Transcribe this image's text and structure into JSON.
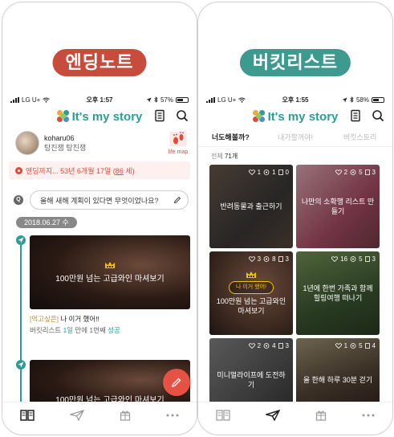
{
  "left": {
    "label": "엔딩노트",
    "status": {
      "carrier": "LG U+",
      "time": "오후 1:57",
      "battery": "57%",
      "battery_level": 0.57
    },
    "app": {
      "logo_text": "It's my story"
    },
    "profile": {
      "username": "koharu06",
      "subtitle": "탕진잼 탕진잼",
      "lifemap_label": "life map"
    },
    "ending": {
      "prefix": "엔딩까지... 53년 6개월 17일 (",
      "age": "86",
      "suffix": " 세)"
    },
    "question": {
      "badge": "Q",
      "text": "올해 새해 계획이 있다면 무엇이었나요?"
    },
    "date": "2018.06.27 수",
    "entries": [
      {
        "card_title": "100만원 넘는 고급와인 마셔보기",
        "tag": "[먹고싶은]",
        "text": " 나 이거 했어!!",
        "meta_prefix": "버킷리스트 ",
        "meta_count": "1일",
        "meta_middle": " 만에 1번째 ",
        "meta_status": "성공"
      },
      {
        "card_title": "100만원 넘는 고급와인 마셔보기"
      }
    ],
    "nav": [
      "book-icon",
      "send-icon",
      "gift-icon",
      "more-icon"
    ]
  },
  "right": {
    "label": "버킷리스트",
    "status": {
      "carrier": "LG U+",
      "time": "오후 1:55",
      "battery": "58%",
      "battery_level": 0.58
    },
    "app": {
      "logo_text": "It's my story"
    },
    "tabs": [
      "너도해볼까?",
      "내가할꺼야!",
      "버킷스토리"
    ],
    "total": {
      "label": "전체 ",
      "count": "71개"
    },
    "cards": [
      {
        "title": "반려동물과 출근하기",
        "likes": "1",
        "views": "1",
        "count": "0",
        "badge": ""
      },
      {
        "title": "나만의 소확행 리스트 만들기",
        "likes": "2",
        "views": "5",
        "count": "3",
        "badge": ""
      },
      {
        "title": "100만원 넘는 고급와인 마셔보기",
        "likes": "3",
        "views": "8",
        "count": "3",
        "badge": "나 이거 했어!"
      },
      {
        "title": "1년에 한번 가족과 함께 힐링여행 떠나기",
        "likes": "16",
        "views": "5",
        "count": "3",
        "badge": ""
      },
      {
        "title": "미니멀라이프에 도전하기",
        "likes": "2",
        "views": "4",
        "count": "3",
        "badge": ""
      },
      {
        "title": "올 한해 하루 30분 걷기",
        "likes": "1",
        "views": "5",
        "count": "4",
        "badge": ""
      }
    ]
  },
  "colors": {
    "red": "#e04a3a",
    "teal": "#2a9e96",
    "pill_red": "#c84c3c",
    "pill_teal": "#3c9b8e",
    "gold": "#f2c200"
  }
}
